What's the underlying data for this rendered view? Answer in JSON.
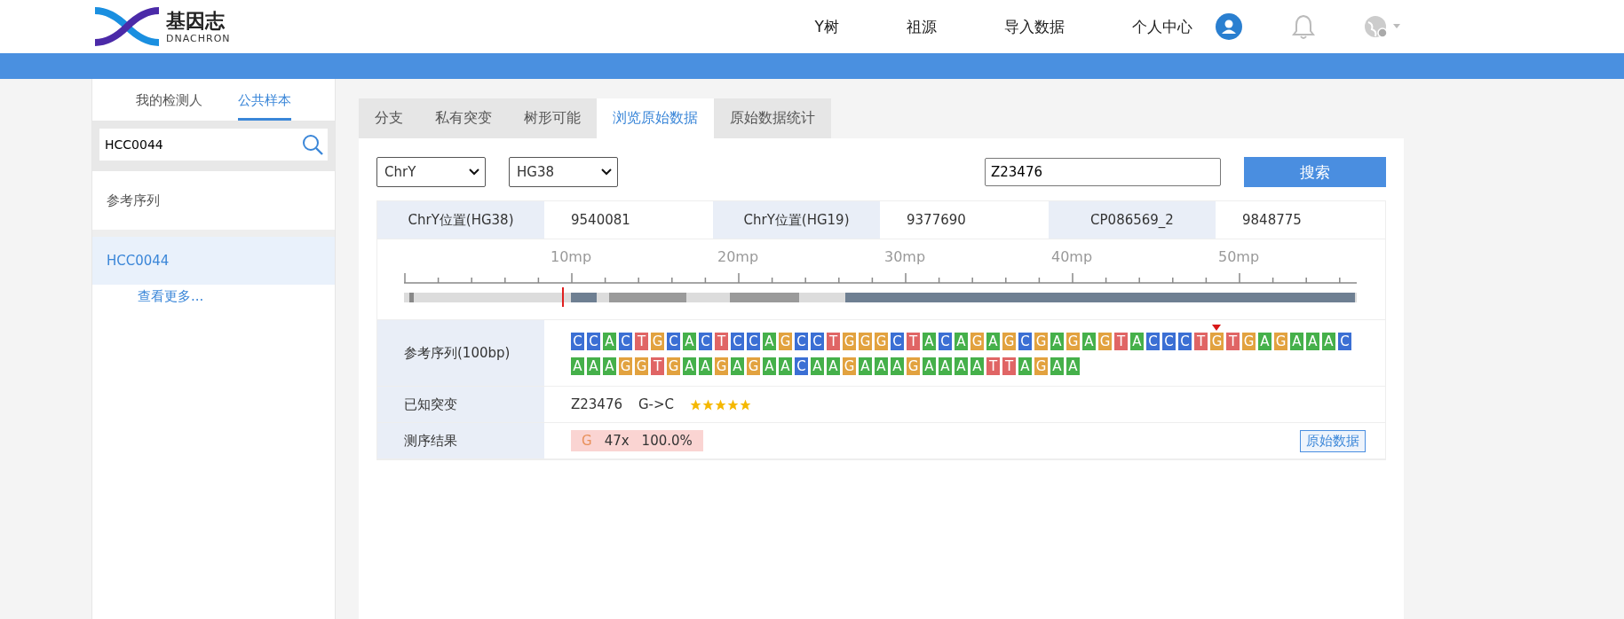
{
  "header": {
    "logo_text": "基因志",
    "logo_subtext": "DNACHRON",
    "nav": [
      {
        "label": "Y树"
      },
      {
        "label": "祖源"
      },
      {
        "label": "导入数据"
      },
      {
        "label": "个人中心"
      }
    ]
  },
  "sidebar": {
    "tabs": [
      {
        "label": "我的检测人",
        "selected": false
      },
      {
        "label": "公共样本",
        "selected": true
      }
    ],
    "search": {
      "value": "HCC0044"
    },
    "items": [
      {
        "label": "参考序列",
        "selected": false
      },
      {
        "label": "HCC0044",
        "selected": true
      }
    ],
    "more_link": "查看更多..."
  },
  "tabs": [
    {
      "label": "分支",
      "selected": false
    },
    {
      "label": "私有突变",
      "selected": false
    },
    {
      "label": "树形可能",
      "selected": false
    },
    {
      "label": "浏览原始数据",
      "selected": true
    },
    {
      "label": "原始数据统计",
      "selected": false
    }
  ],
  "controls": {
    "chromosome": "ChrY",
    "assembly": "HG38",
    "query": "Z23476",
    "search_button": "搜索"
  },
  "positions": [
    {
      "label": "ChrY位置(HG38)",
      "value": "9540081"
    },
    {
      "label": "ChrY位置(HG19)",
      "value": "9377690"
    },
    {
      "label": "CP086569_2",
      "value": "9848775"
    }
  ],
  "axis_labels": [
    "10mp",
    "20mp",
    "30mp",
    "40mp",
    "50mp"
  ],
  "reference": {
    "label": "参考序列(100bp)",
    "lines": [
      {
        "before": [
          "C",
          "C",
          "A",
          "C",
          "T",
          "G",
          "C",
          "A",
          "C",
          "T",
          "C",
          "C",
          "A",
          "G",
          "C",
          "C",
          "T",
          "G",
          "G",
          "G",
          "C",
          "T",
          "A",
          "C",
          "A",
          "G",
          "A",
          "G",
          "C",
          "G",
          "A",
          "G",
          "A",
          "G",
          "T",
          "A",
          "C",
          "C",
          "C",
          "T"
        ],
        "marked": "G",
        "after": [
          "T",
          "G",
          "A",
          "G",
          "A",
          "A",
          "A",
          "C"
        ]
      },
      {
        "before": [
          "A",
          "A",
          "A",
          "G",
          "G",
          "T",
          "G",
          "A",
          "A",
          "G",
          "A",
          "G",
          "A",
          "A",
          "C",
          "A",
          "A",
          "G",
          "A",
          "A",
          "A",
          "G",
          "A",
          "A",
          "A",
          "A",
          "T",
          "T",
          "A",
          "G",
          "A",
          "A"
        ]
      }
    ]
  },
  "known_mutation": {
    "label": "已知突变",
    "name": "Z23476",
    "change": "G->C",
    "stars": 5
  },
  "result": {
    "label": "测序结果",
    "base": "G",
    "depth": "47x",
    "percent": "100.0%",
    "raw_button": "原始数据"
  }
}
